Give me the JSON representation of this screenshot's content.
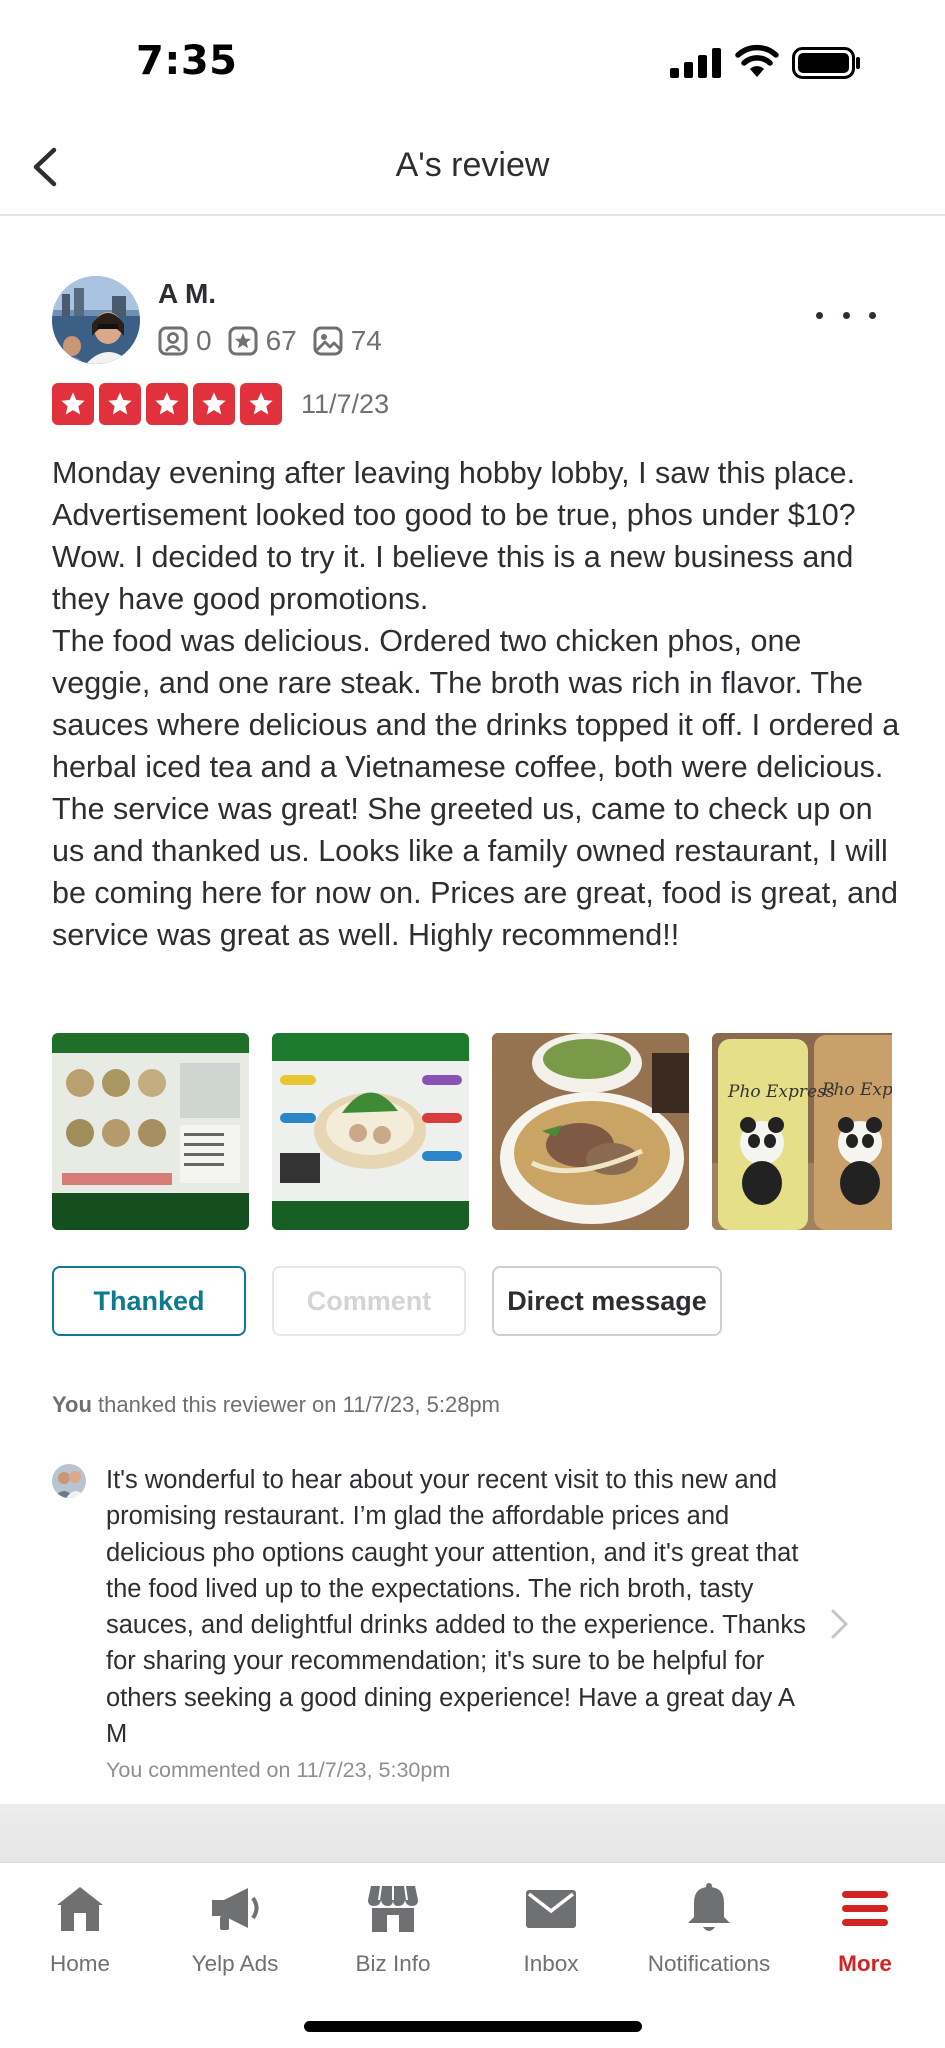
{
  "status_bar": {
    "time": "7:35"
  },
  "header": {
    "title": "A's review"
  },
  "reviewer": {
    "name": "A M.",
    "friends_count": "0",
    "reviews_count": "67",
    "photos_count": "74"
  },
  "review": {
    "rating": 5,
    "date": "11/7/23",
    "text": "Monday evening after leaving hobby lobby, I saw this place. Advertisement looked too good to be true, phos under $10? Wow. I decided to try it. I believe this is a new business and they have good promotions.\nThe food was delicious. Ordered two chicken phos, one veggie, and one rare steak. The broth was rich in flavor. The sauces where delicious and the drinks topped it off. I ordered a herbal iced tea and a Vietnamese coffee, both were delicious. The service was great! She greeted us, came to check up on us and thanked us. Looks like a family owned restaurant, I will be coming here for now on. Prices are great, food is great, and service was great as well. Highly recommend!!",
    "photos": [
      "menu-board-photo",
      "pho-poster-photo",
      "pho-bowls-photo",
      "pho-express-drinks-photo"
    ],
    "photo_texts": [
      "Pho Express",
      "Pho Express"
    ]
  },
  "actions": {
    "thanked_label": "Thanked",
    "comment_label": "Comment",
    "dm_label": "Direct message"
  },
  "thanked_note": {
    "who": "You",
    "text": " thanked this reviewer on 11/7/23, 5:28pm"
  },
  "comment": {
    "text": "It's wonderful to hear about your recent visit to this new and promising restaurant. I’m glad the affordable prices and delicious pho options caught your attention, and it's great that the food lived up to the expectations. The rich broth, tasty sauces, and delightful drinks added to the experience. Thanks for sharing your recommendation; it's sure to be helpful for others seeking a good dining experience! Have a great day A M",
    "meta": "You commented on 11/7/23, 5:30pm"
  },
  "tabs": [
    {
      "label": "Home",
      "icon": "home-icon"
    },
    {
      "label": "Yelp Ads",
      "icon": "megaphone-icon"
    },
    {
      "label": "Biz Info",
      "icon": "storefront-icon"
    },
    {
      "label": "Inbox",
      "icon": "envelope-icon"
    },
    {
      "label": "Notifications",
      "icon": "bell-icon"
    },
    {
      "label": "More",
      "icon": "hamburger-icon",
      "active": true
    }
  ],
  "colors": {
    "star_red": "#e0313c",
    "active_tab": "#d32323",
    "thanked_teal": "#0e7a8d"
  }
}
